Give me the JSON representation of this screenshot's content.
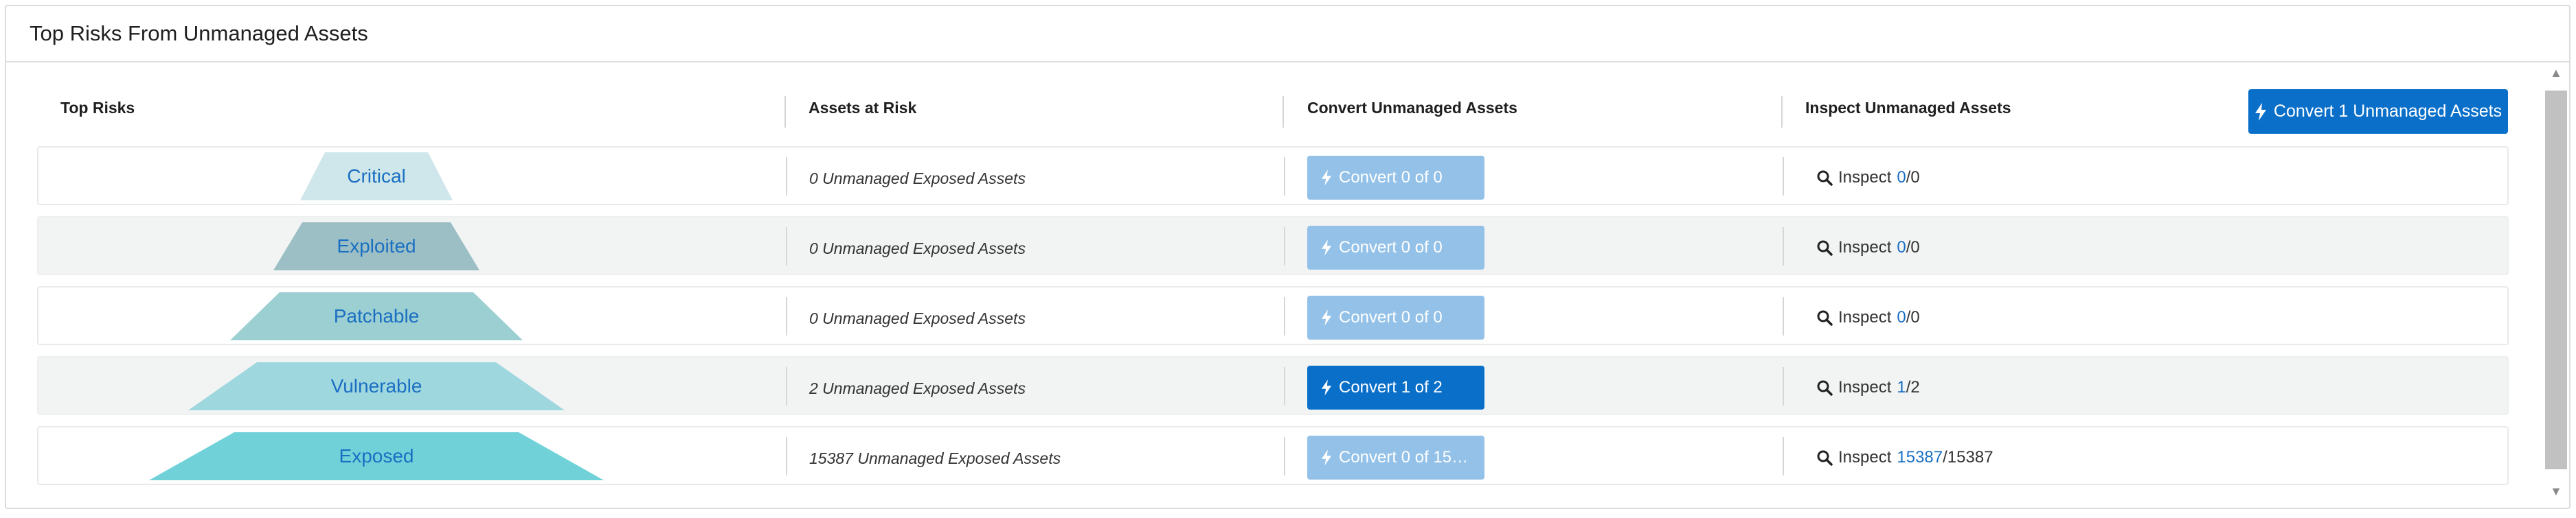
{
  "panel": {
    "title": "Top Risks From Unmanaged Assets"
  },
  "columns": {
    "top_risks": "Top Risks",
    "assets_at_risk": "Assets at Risk",
    "convert": "Convert Unmanaged Assets",
    "inspect": "Inspect Unmanaged Assets"
  },
  "primary_action": {
    "label": "Convert 1 Unmanaged Assets",
    "icon": "bolt-icon"
  },
  "rows": [
    {
      "level": "Critical",
      "color": "#cfe7ea",
      "assets": "0 Unmanaged Exposed Assets",
      "convert": "Convert 0 of 0",
      "convert_enabled": false,
      "inspect_prefix": "Inspect",
      "inspect_link": "0",
      "inspect_total": "/0"
    },
    {
      "level": "Exploited",
      "color": "#9bbfc4",
      "assets": "0 Unmanaged Exposed Assets",
      "convert": "Convert 0 of 0",
      "convert_enabled": false,
      "inspect_prefix": "Inspect",
      "inspect_link": "0",
      "inspect_total": "/0"
    },
    {
      "level": "Patchable",
      "color": "#9ccfd2",
      "assets": "0 Unmanaged Exposed Assets",
      "convert": "Convert 0 of 0",
      "convert_enabled": false,
      "inspect_prefix": "Inspect",
      "inspect_link": "0",
      "inspect_total": "/0"
    },
    {
      "level": "Vulnerable",
      "color": "#9fd7df",
      "assets": "2 Unmanaged Exposed Assets",
      "convert": "Convert 1 of 2",
      "convert_enabled": true,
      "inspect_prefix": "Inspect",
      "inspect_link": "1",
      "inspect_total": "/2"
    },
    {
      "level": "Exposed",
      "color": "#70d1d9",
      "assets": "15387 Unmanaged Exposed Assets",
      "convert": "Convert 0 of 15…",
      "convert_enabled": false,
      "inspect_prefix": "Inspect",
      "inspect_link": "15387",
      "inspect_total": "/15387"
    }
  ]
}
